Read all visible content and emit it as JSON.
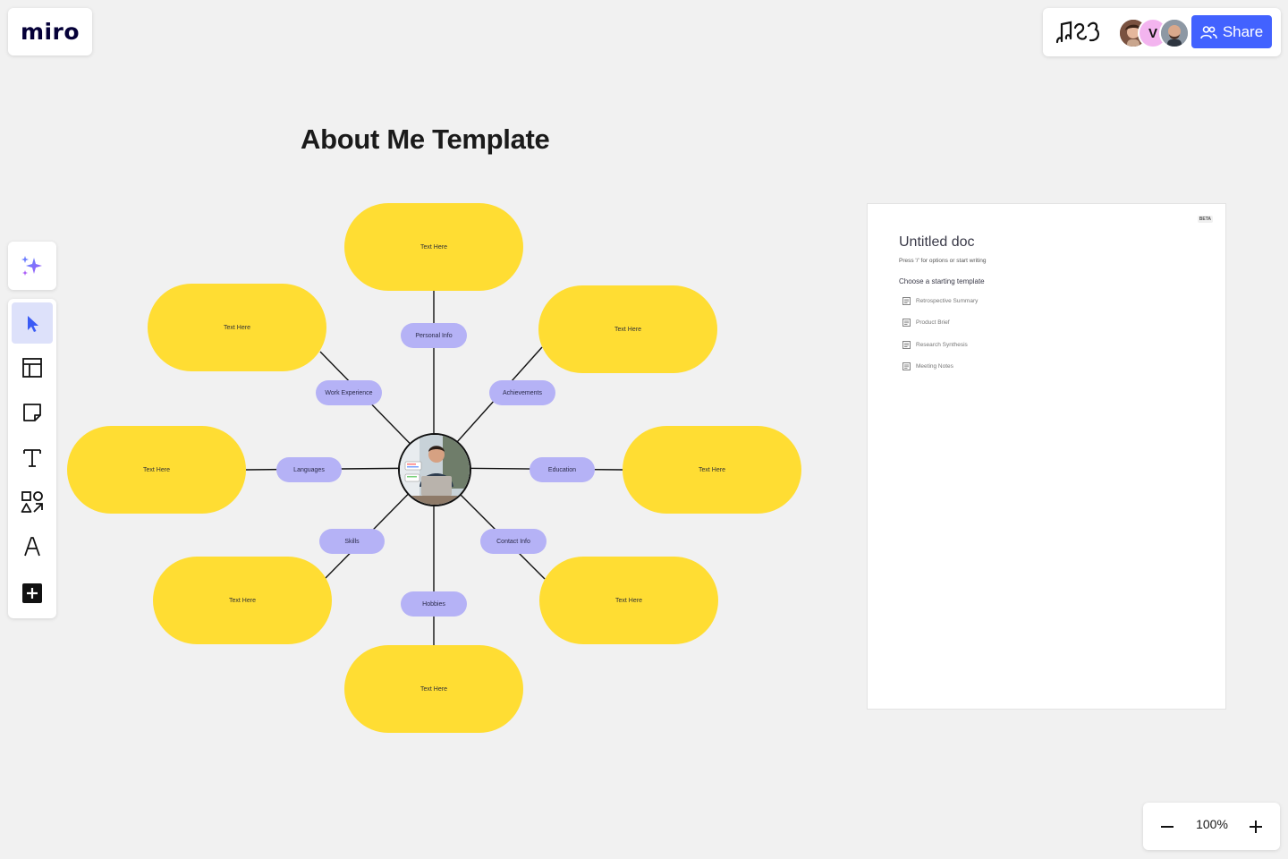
{
  "logo": {
    "text": "miro"
  },
  "header": {
    "share_label": "Share",
    "avatar_initial": "V"
  },
  "board": {
    "title": "About Me Template"
  },
  "mindmap": {
    "bubbles": [
      "Text Here",
      "Text Here",
      "Text Here",
      "Text Here",
      "Text Here",
      "Text Here",
      "Text Here",
      "Text Here"
    ],
    "categories": [
      "Personal Info",
      "Work Experience",
      "Achievements",
      "Languages",
      "Education",
      "Skills",
      "Contact Info",
      "Hobbies"
    ]
  },
  "doc": {
    "badge": "BETA",
    "title": "Untitled doc",
    "hint": "Press '/' for options or start writing",
    "choose_label": "Choose a starting template",
    "templates": [
      "Retrospective Summary",
      "Product Brief",
      "Research Synthesis",
      "Meeting Notes"
    ]
  },
  "zoom": {
    "level": "100%"
  },
  "colors": {
    "accent": "#4262ff",
    "bubble": "#ffdd33",
    "pill": "#b5b2f6",
    "active_tool": "#dde1fa"
  }
}
